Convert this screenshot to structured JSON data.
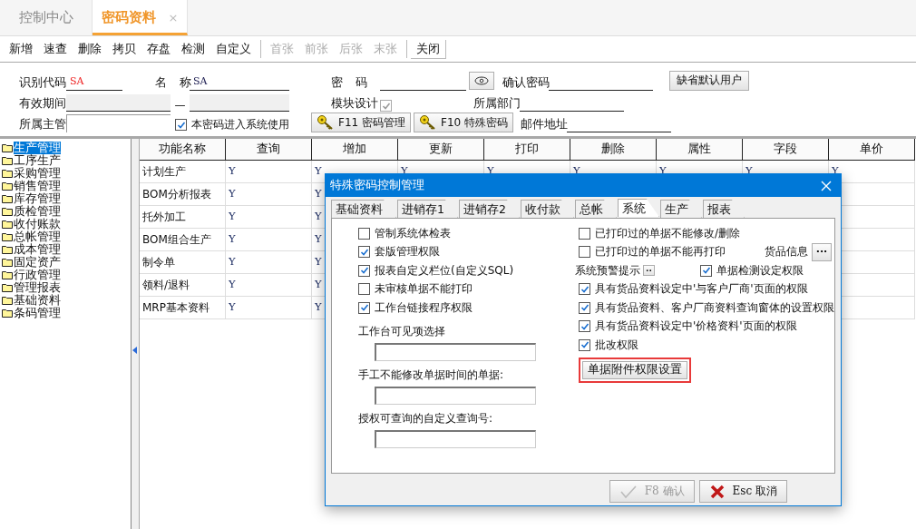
{
  "tabs": [
    {
      "label": "控制中心",
      "selected": false
    },
    {
      "label": "密码资料",
      "selected": true,
      "close": "×"
    }
  ],
  "toolbar": [
    [
      {
        "label": "新增",
        "disabled": false
      },
      {
        "label": "速查",
        "disabled": false
      },
      {
        "label": "删除",
        "disabled": false
      },
      {
        "label": "拷贝",
        "disabled": false
      },
      {
        "label": "存盘",
        "disabled": false
      },
      {
        "label": "检测",
        "disabled": false
      },
      {
        "label": "自定义",
        "disabled": false
      }
    ],
    [
      {
        "label": "首张",
        "disabled": true
      },
      {
        "label": "前张",
        "disabled": true
      },
      {
        "label": "后张",
        "disabled": true
      },
      {
        "label": "末张",
        "disabled": true
      }
    ],
    [
      {
        "label": "关闭",
        "disabled": false
      }
    ]
  ],
  "form": {
    "code": {
      "label": "识别代码",
      "value": "SA"
    },
    "name": {
      "label": "名 称",
      "value": "SA"
    },
    "password": {
      "label": "密 码"
    },
    "confirm": {
      "label": "确认密码"
    },
    "default_user_button": "缺省默认用户",
    "valid_period": {
      "label": "有效期间",
      "separator": "—"
    },
    "module_design": {
      "label": "模块设计",
      "checked": true,
      "disabled": true
    },
    "department": {
      "label": "所属部门"
    },
    "supervisor": {
      "label": "所属主管"
    },
    "system_use": {
      "label": "本密码进入系统使用",
      "checked": true
    },
    "f11_button": "F11 密码管理",
    "f10_button": "F10 特殊密码",
    "email": {
      "label": "邮件地址"
    }
  },
  "sidebar": {
    "items": [
      {
        "label": "生产管理",
        "selected": true
      },
      {
        "label": "工序生产",
        "selected": false
      },
      {
        "label": "采购管理",
        "selected": false
      },
      {
        "label": "销售管理",
        "selected": false
      },
      {
        "label": "库存管理",
        "selected": false
      },
      {
        "label": "质检管理",
        "selected": false
      },
      {
        "label": "收付账款",
        "selected": false
      },
      {
        "label": "总帐管理",
        "selected": false
      },
      {
        "label": "成本管理",
        "selected": false
      },
      {
        "label": "固定资产",
        "selected": false
      },
      {
        "label": "行政管理",
        "selected": false
      },
      {
        "label": "管理报表",
        "selected": false
      },
      {
        "label": "基础资料",
        "selected": false
      },
      {
        "label": "条码管理",
        "selected": false
      }
    ]
  },
  "table": {
    "columns": [
      "功能名称",
      "查询",
      "增加",
      "更新",
      "打印",
      "删除",
      "属性",
      "字段",
      "单价"
    ],
    "rows": [
      [
        "计划生产",
        "Y",
        "Y",
        "Y",
        "Y",
        "Y",
        "Y",
        "Y",
        "Y"
      ],
      [
        "BOM分析报表",
        "Y",
        "Y"
      ],
      [
        "托外加工",
        "Y",
        "Y"
      ],
      [
        "BOM组合生产",
        "Y",
        "Y"
      ],
      [
        "制令单",
        "Y",
        "Y"
      ],
      [
        "领料/退料",
        "Y",
        "Y"
      ],
      [
        "MRP基本资料",
        "Y",
        "Y"
      ]
    ]
  },
  "dialog": {
    "title": "特殊密码控制管理",
    "tabs": [
      {
        "label": "基础资料",
        "selected": false
      },
      {
        "label": "进销存1",
        "selected": false
      },
      {
        "label": "进销存2",
        "selected": false
      },
      {
        "label": "收付款",
        "selected": false
      },
      {
        "label": "总帐",
        "selected": false
      },
      {
        "label": "系统",
        "selected": true
      },
      {
        "label": "生产",
        "selected": false
      },
      {
        "label": "报表",
        "selected": false
      }
    ],
    "left_checks": [
      {
        "label": "管制系统体检表",
        "checked": false
      },
      {
        "label": "套版管理权限",
        "checked": true
      },
      {
        "label": "报表自定义栏位(自定义SQL)",
        "checked": true
      },
      {
        "label": "未审核单据不能打印",
        "checked": false
      },
      {
        "label": "工作台链接程序权限",
        "checked": true
      }
    ],
    "left_fields": [
      {
        "label": "工作台可见项选择"
      },
      {
        "label": "手工不能修改单据时间的单据:"
      },
      {
        "label": "授权可查询的自定义查询号:"
      }
    ],
    "right_rows": [
      {
        "kind": "checkbox",
        "label": "已打印过的单据不能修改/删除",
        "checked": false
      },
      {
        "kind": "checkbox_side",
        "label": "已打印过的单据不能再打印",
        "checked": false,
        "side_label": "货品信息",
        "side_button": "···"
      },
      {
        "kind": "alert",
        "label": "系统预警提示",
        "button": "··",
        "check_label": "单据检测设定权限",
        "checked": true
      },
      {
        "kind": "checkbox",
        "label": "具有货品资料设定中'与客户厂商'页面的权限",
        "checked": true
      },
      {
        "kind": "checkbox",
        "label": "具有货品资料、客户厂商资料查询窗体的设置权限",
        "checked": true
      },
      {
        "kind": "checkbox",
        "label": "具有货品资料设定中'价格资料'页面的权限",
        "checked": true
      },
      {
        "kind": "checkbox",
        "label": "批改权限",
        "checked": true
      }
    ],
    "attachment_button": {
      "label": "单据附件权限设置",
      "highlighted": true
    },
    "ok_button": {
      "label": "F8 确认",
      "disabled": true
    },
    "cancel_button": {
      "label": "Esc 取消",
      "disabled": false
    }
  }
}
